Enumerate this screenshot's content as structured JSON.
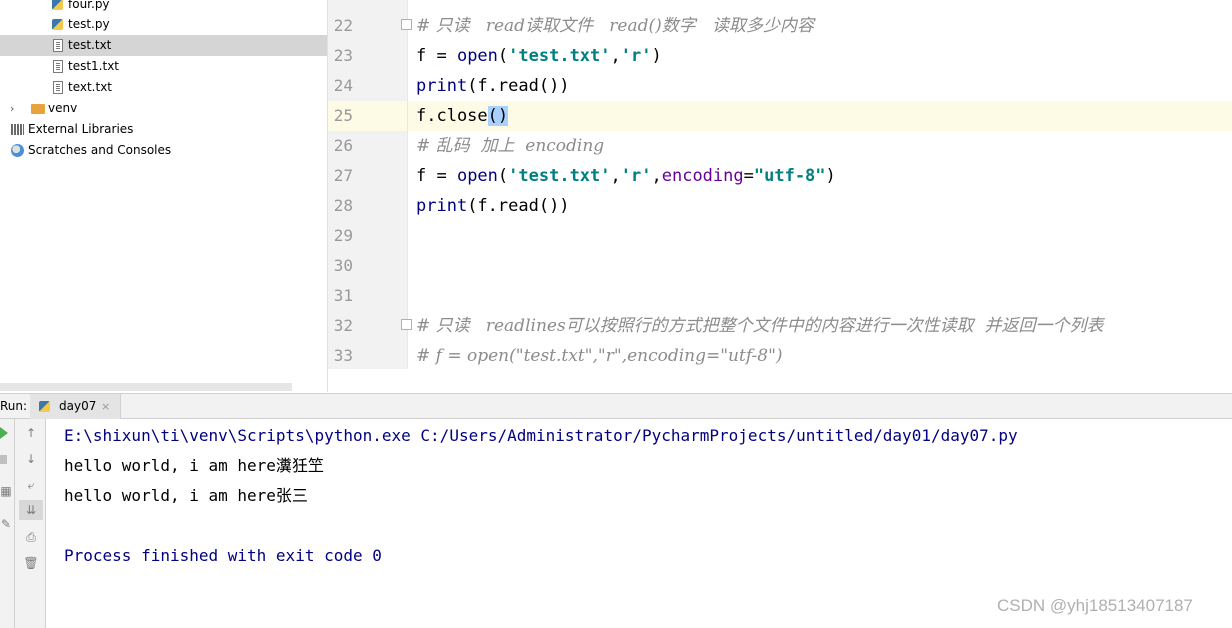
{
  "project_tree": [
    {
      "label": "four.py",
      "icon": "python-file-icon",
      "selected": false
    },
    {
      "label": "test.py",
      "icon": "python-file-icon",
      "selected": false
    },
    {
      "label": "test.txt",
      "icon": "text-file-icon",
      "selected": true
    },
    {
      "label": "test1.txt",
      "icon": "text-file-icon",
      "selected": false
    },
    {
      "label": "text.txt",
      "icon": "text-file-icon",
      "selected": false
    },
    {
      "label": "venv",
      "icon": "folder-icon",
      "selected": false
    },
    {
      "label": "External Libraries",
      "icon": "library-icon",
      "selected": false
    },
    {
      "label": "Scratches and Consoles",
      "icon": "scratches-icon",
      "selected": false
    }
  ],
  "editor": {
    "line_numbers": [
      "22",
      "23",
      "24",
      "25",
      "26",
      "27",
      "28",
      "29",
      "30",
      "31",
      "32",
      "33"
    ],
    "lines": {
      "l22": "# 只读   read读取文件   read()数字   读取多少内容",
      "l23": {
        "a": "f = ",
        "b": "open",
        "c": "(",
        "d": "'test.txt'",
        "e": ",",
        "f": "'r'",
        "g": ")"
      },
      "l24": {
        "a": "print",
        "b": "(f.read())"
      },
      "l25": {
        "a": "f.close",
        "b": "()"
      },
      "l26": "# 乱码  加上  encoding",
      "l27": {
        "a": "f = ",
        "b": "open",
        "c": "(",
        "d": "'test.txt'",
        "e": ",",
        "f": "'r'",
        "g": ",",
        "h": "encoding",
        "i": "=",
        "j": "\"utf-8\"",
        "k": ")"
      },
      "l28": {
        "a": "print",
        "b": "(f.read())"
      },
      "l32": "# 只读   readlines可以按照行的方式把整个文件中的内容进行一次性读取  并返回一个列表",
      "l33": "# f = open(\"test.txt\",\"r\",encoding=\"utf-8\")"
    }
  },
  "run": {
    "label": "Run:",
    "tab": "day07",
    "close": "×",
    "console": [
      "E:\\shixun\\ti\\venv\\Scripts\\python.exe C:/Users/Administrator/PycharmProjects/untitled/day01/day07.py",
      "hello world, i am here瀵狅笁",
      "hello world, i am here张三",
      "",
      "Process finished with exit code 0"
    ]
  },
  "watermark": "CSDN @yhj18513407187"
}
